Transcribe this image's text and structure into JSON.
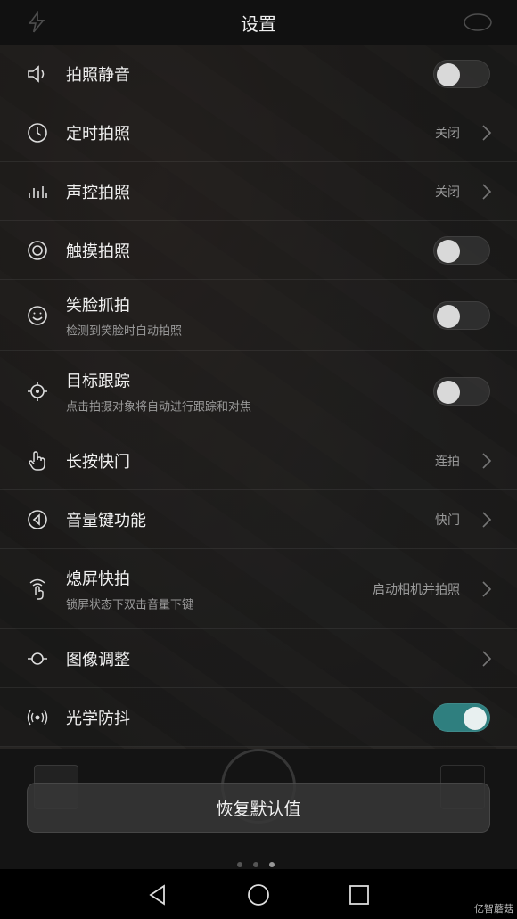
{
  "header": {
    "title": "设置"
  },
  "settings": [
    {
      "icon": "speaker-mute-icon",
      "label": "拍照静音",
      "control": "toggle",
      "on": false
    },
    {
      "icon": "timer-icon",
      "label": "定时拍照",
      "control": "link",
      "value": "关闭"
    },
    {
      "icon": "audio-bars-icon",
      "label": "声控拍照",
      "control": "link",
      "value": "关闭"
    },
    {
      "icon": "touch-circle-icon",
      "label": "触摸拍照",
      "control": "toggle",
      "on": false
    },
    {
      "icon": "smile-icon",
      "label": "笑脸抓拍",
      "sub": "检测到笑脸时自动拍照",
      "control": "toggle",
      "on": false
    },
    {
      "icon": "crosshair-icon",
      "label": "目标跟踪",
      "sub": "点击拍摄对象将自动进行跟踪和对焦",
      "control": "toggle",
      "on": false
    },
    {
      "icon": "hand-press-icon",
      "label": "长按快门",
      "control": "link",
      "value": "连拍"
    },
    {
      "icon": "volume-key-icon",
      "label": "音量键功能",
      "control": "link",
      "value": "快门"
    },
    {
      "icon": "screen-off-tap-icon",
      "label": "熄屏快拍",
      "sub": "锁屏状态下双击音量下键",
      "control": "link",
      "value": "启动相机并拍照"
    },
    {
      "icon": "image-adjust-icon",
      "label": "图像调整",
      "control": "link"
    },
    {
      "icon": "stabilization-icon",
      "label": "光学防抖",
      "control": "toggle",
      "on": true
    }
  ],
  "reset_button": "恢复默认值",
  "watermark": "亿智蘑菇"
}
